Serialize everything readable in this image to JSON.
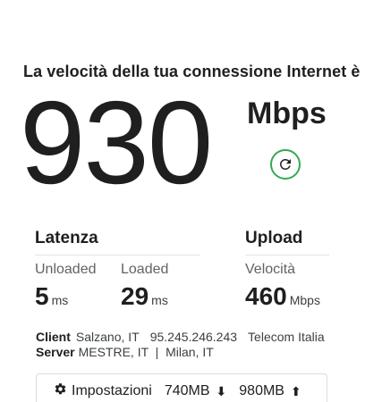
{
  "result": {
    "heading": "La velocità della tua connessione Internet è",
    "speed_value": "930",
    "speed_unit": "Mbps"
  },
  "latency": {
    "title": "Latenza",
    "unloaded_label": "Unloaded",
    "unloaded_value": "5",
    "unloaded_unit": "ms",
    "loaded_label": "Loaded",
    "loaded_value": "29",
    "loaded_unit": "ms"
  },
  "upload": {
    "title": "Upload",
    "speed_label": "Velocità",
    "speed_value": "460",
    "speed_unit": "Mbps"
  },
  "client": {
    "label": "Client",
    "location": "Salzano, IT",
    "ip": "95.245.246.243",
    "isp": "Telecom Italia"
  },
  "server": {
    "label": "Server",
    "locations": "MESTRE, IT  |  Milan, IT"
  },
  "footer": {
    "settings_label": "Impostazioni",
    "downloaded": "740MB",
    "download_arrow": "⬇",
    "uploaded": "980MB",
    "upload_arrow": "⬆"
  },
  "icons": {
    "refresh": "refresh-icon",
    "settings": "gear-icon"
  },
  "colors": {
    "accent": "#34a853",
    "text": "#1f1f1f",
    "muted": "#5f6368"
  }
}
